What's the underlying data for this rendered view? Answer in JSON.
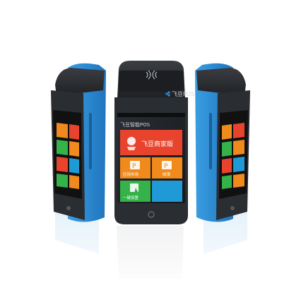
{
  "brand": {
    "logo_text": "飞豆POS"
  },
  "screen": {
    "title": "飞豆智能POS",
    "tiles": [
      {
        "label": "飞豆商家版",
        "color": "#e8442d"
      },
      {
        "label": "应用市场",
        "color": "#f08a1c"
      },
      {
        "label": "收银",
        "color": "#f08a1c"
      },
      {
        "label": "一键设置",
        "color": "#35b24a"
      },
      {
        "label": "",
        "color": "#1f9ad6"
      }
    ]
  },
  "colors": {
    "body_blue": "#2f8fd6",
    "body_dark": "#2a2d31",
    "screen_bg": "#1b1d21"
  }
}
